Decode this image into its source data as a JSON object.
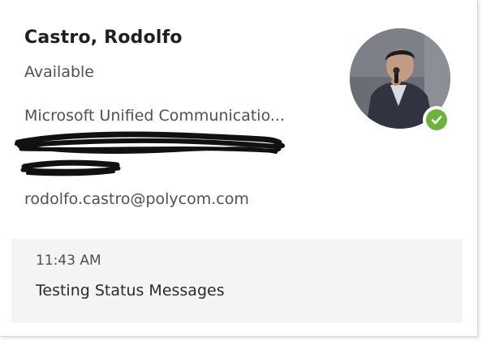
{
  "contact": {
    "name": "Castro, Rodolfo",
    "presence": "Available",
    "organization": "Microsoft Unified Communicatio...",
    "email": "rodolfo.castro@polycom.com"
  },
  "avatar": {
    "icon": "avatar-photo",
    "presence_badge_icon": "checkmark-icon",
    "presence_color": "#6bb33d"
  },
  "status_note": {
    "time": "11:43 AM",
    "message": "Testing Status Messages"
  }
}
